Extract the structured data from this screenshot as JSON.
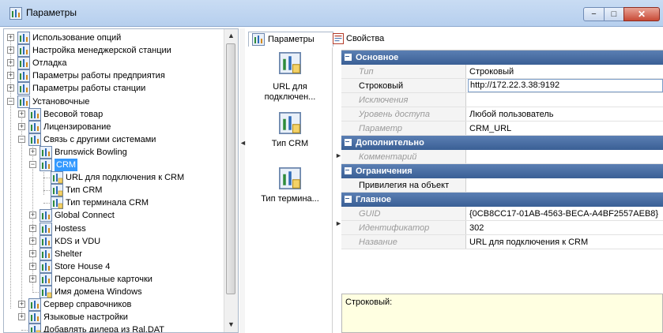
{
  "window": {
    "title": "Параметры",
    "min_glyph": "−",
    "max_glyph": "□",
    "close_glyph": "✕"
  },
  "tree": {
    "items": [
      {
        "label": "Использование опций",
        "expander": "+"
      },
      {
        "label": "Настройка менеджерской станции",
        "expander": "+"
      },
      {
        "label": "Отладка",
        "expander": "+"
      },
      {
        "label": "Параметры работы предприятия",
        "expander": "+"
      },
      {
        "label": "Параметры работы станции",
        "expander": "+"
      },
      {
        "label": "Установочные",
        "expander": "−"
      },
      {
        "label": "Весовой товар",
        "expander": "+"
      },
      {
        "label": "Лицензирование",
        "expander": "+"
      },
      {
        "label": "Связь с другими системами",
        "expander": "−"
      },
      {
        "label": "Brunswick Bowling",
        "expander": "+"
      },
      {
        "label": "CRM",
        "expander": "−"
      },
      {
        "label": "URL для подключения к CRM",
        "expander": ""
      },
      {
        "label": "Тип CRM",
        "expander": ""
      },
      {
        "label": "Тип терминала CRM",
        "expander": ""
      },
      {
        "label": "Global Connect",
        "expander": "+"
      },
      {
        "label": "Hostess",
        "expander": "+"
      },
      {
        "label": "KDS и VDU",
        "expander": "+"
      },
      {
        "label": "Shelter",
        "expander": "+"
      },
      {
        "label": "Store House 4",
        "expander": "+"
      },
      {
        "label": "Персональные карточки",
        "expander": "+"
      },
      {
        "label": "Имя домена Windows",
        "expander": ""
      },
      {
        "label": "Сервер справочников",
        "expander": "+"
      },
      {
        "label": "Языковые настройки",
        "expander": "+"
      },
      {
        "label": "Добавлять дилера из Ral.DAT",
        "expander": ""
      }
    ],
    "scroll_up": "▲",
    "scroll_down": "▼"
  },
  "splitter": {
    "left_arrow": "◄",
    "right_arrow": "►"
  },
  "tabs": [
    {
      "label": "Параметры"
    },
    {
      "label": "Свойства"
    }
  ],
  "strip": {
    "items": [
      {
        "label": "URL для подключен..."
      },
      {
        "label": "Тип CRM"
      },
      {
        "label": "Тип термина..."
      }
    ]
  },
  "properties": {
    "cat_main": "Основное",
    "type_label": "Тип",
    "type_value": "Строковый",
    "string_label": "Строковый",
    "string_value": "http://172.22.3.38:9192",
    "exceptions_label": "Исключения",
    "access_label": "Уровень доступа",
    "access_value": "Любой пользователь",
    "param_label": "Параметр",
    "param_value": "CRM_URL",
    "cat_extra": "Дополнительно",
    "comment_label": "Комментарий",
    "comment_value": "",
    "cat_limits": "Ограничения",
    "privilege_label": "Привилегия на объект",
    "privilege_value": "",
    "cat_general": "Главное",
    "guid_label": "GUID",
    "guid_value": "{0CB8CC17-01AB-4563-BECA-A4BF2557AEB8}",
    "id_label": "Идентификатор",
    "id_value": "302",
    "name_label": "Название",
    "name_value": "URL для подключения к CRM"
  },
  "description": {
    "text": "Строковый:"
  },
  "colors": {
    "accent": "#3a5f95",
    "selection": "#3399ff",
    "desc_bg": "#ffffe1"
  }
}
